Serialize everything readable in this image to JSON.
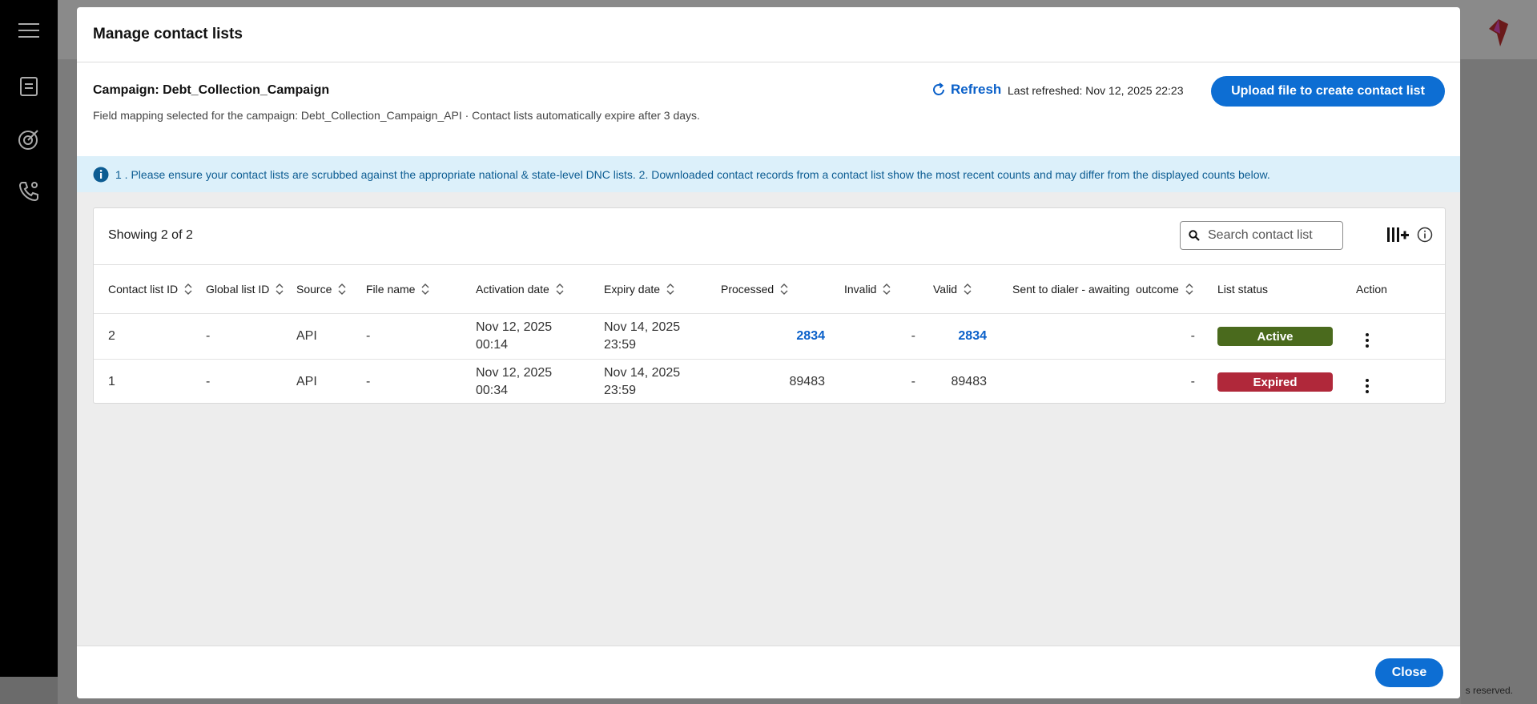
{
  "background": {
    "footer_text": "s reserved."
  },
  "modal": {
    "title": "Manage contact lists",
    "campaign_label": "Campaign: Debt_Collection_Campaign",
    "field_mapping_text": "Field mapping selected for the campaign: Debt_Collection_Campaign_API · Contact lists automatically expire after 3 days.",
    "refresh_label": "Refresh",
    "last_refreshed": "Last refreshed: Nov 12, 2025 22:23",
    "upload_label": "Upload file to create contact list",
    "info_banner": "1 . Please ensure your contact lists are scrubbed against the appropriate national & state-level DNC lists. 2. Downloaded contact records from a contact list show the most recent counts and may differ from the displayed counts below.",
    "close_label": "Close"
  },
  "table": {
    "showing": "Showing 2 of 2",
    "search_placeholder": "Search contact list",
    "columns": {
      "contact_list_id": "Contact list ID",
      "global_list_id": "Global list ID",
      "source": "Source",
      "file_name": "File name",
      "activation_date": "Activation date",
      "expiry_date": "Expiry date",
      "processed": "Processed",
      "invalid": "Invalid",
      "valid": "Valid",
      "sent_to_dialer": "Sent to dialer - awaiting  outcome",
      "list_status": "List status",
      "action": "Action"
    },
    "rows": [
      {
        "contact_list_id": "2",
        "global_list_id": "-",
        "source": "API",
        "file_name": "-",
        "activation_date_1": "Nov 12, 2025",
        "activation_date_2": "00:14",
        "expiry_date_1": "Nov 14, 2025",
        "expiry_date_2": "23:59",
        "processed": "2834",
        "invalid": "-",
        "valid": "2834",
        "sent_to_dialer": "-",
        "status": "Active",
        "status_color": "#4a6a1d"
      },
      {
        "contact_list_id": "1",
        "global_list_id": "-",
        "source": "API",
        "file_name": "-",
        "activation_date_1": "Nov 12, 2025",
        "activation_date_2": "00:34",
        "expiry_date_1": "Nov 14, 2025",
        "expiry_date_2": "23:59",
        "processed": "89483",
        "invalid": "-",
        "valid": "89483",
        "sent_to_dialer": "-",
        "status": "Expired",
        "status_color": "#b0283a"
      }
    ]
  },
  "colors": {
    "accent": "#0d6ed3",
    "banner_bg": "#dcf0fa",
    "banner_text": "#0c5c92"
  }
}
